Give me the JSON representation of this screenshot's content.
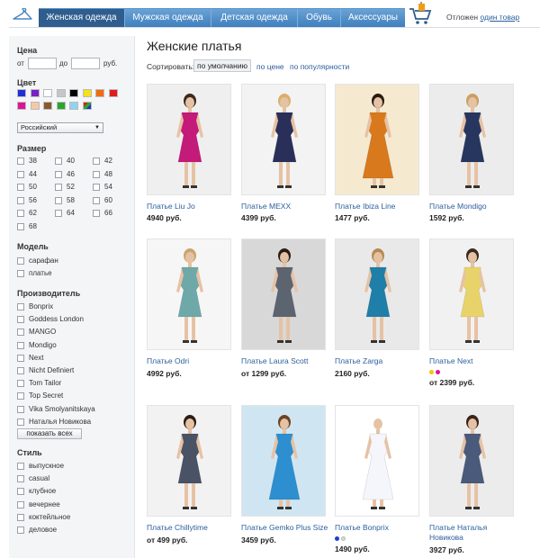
{
  "nav": {
    "tabs": [
      {
        "label": "Женская одежда",
        "active": true
      },
      {
        "label": "Мужская одежда",
        "active": false
      },
      {
        "label": "Детская одежда",
        "active": false
      },
      {
        "label": "Обувь",
        "active": false
      },
      {
        "label": "Аксессуары",
        "active": false
      }
    ],
    "deferred_text": "Отложен",
    "deferred_link": "один товар",
    "colors": {
      "bar": "#4a86c3",
      "active": "#2f5d8e"
    }
  },
  "sidebar": {
    "price": {
      "title": "Цена",
      "from": "от",
      "to": "до",
      "unit": "руб.",
      "from_value": "",
      "to_value": ""
    },
    "color": {
      "title": "Цвет",
      "swatches": [
        "#1f2fd4",
        "#7a1fc4",
        "#ffffff",
        "#c6c6c6",
        "#000000",
        "#f7e017",
        "#f26b0f",
        "#e11b1b",
        "#e0129a",
        "#f6c8a8",
        "#8a5a2b",
        "#28a52a",
        "#8fd3f0",
        "multicolor"
      ]
    },
    "country_select": "Российский",
    "size": {
      "title": "Размер",
      "values": [
        "38",
        "40",
        "42",
        "44",
        "46",
        "48",
        "50",
        "52",
        "54",
        "56",
        "58",
        "60",
        "62",
        "64",
        "66",
        "68"
      ]
    },
    "model": {
      "title": "Модель",
      "items": [
        "сарафан",
        "платье"
      ]
    },
    "brand": {
      "title": "Производитель",
      "items": [
        "Bonprix",
        "Goddess London",
        "MANGO",
        "Mondigo",
        "Next",
        "Nicht Definiert",
        "Tom Tailor",
        "Top Secret",
        "Vika Smolyanitskaya",
        "Наталья Новикова"
      ],
      "show_all": "показать всех"
    },
    "style": {
      "title": "Стиль",
      "items": [
        "выпускное",
        "casual",
        "клубное",
        "вечернее",
        "коктейльное",
        "деловое"
      ]
    }
  },
  "main": {
    "title": "Женские платья",
    "sort": {
      "label": "Сортировать:",
      "default": "по умолчанию",
      "by_price": "по цене",
      "by_popularity": "по популярности"
    },
    "products": [
      {
        "name": "Платье Liu Jo",
        "price": "4940 руб.",
        "dress": "#c41a7a",
        "bg": "#efefef",
        "hair": "#3a2a1e",
        "short": true,
        "dots": []
      },
      {
        "name": "Платье MEXX",
        "price": "4399 руб.",
        "dress": "#2a2f5a",
        "bg": "#f3f3f3",
        "hair": "#d8b06a",
        "short": true,
        "dots": []
      },
      {
        "name": "Платье Ibiza Line",
        "price": "1477 руб.",
        "dress": "#d9791e",
        "bg": "#f5ead0",
        "hair": "#2a1a12",
        "short": false,
        "dots": []
      },
      {
        "name": "Платье Mondigo",
        "price": "1592 руб.",
        "dress": "#27365e",
        "bg": "#ececec",
        "hair": "#c9a062",
        "short": true,
        "dots": []
      },
      {
        "name": "Платье Odri",
        "price": "4992 руб.",
        "dress": "#6fa8a8",
        "bg": "#f6f6f6",
        "hair": "#caa470",
        "short": true,
        "dots": []
      },
      {
        "name": "Платье Laura Scott",
        "price": "от 1299 руб.",
        "dress": "#5c6470",
        "bg": "#d8d8d8",
        "hair": "#2b1d16",
        "short": true,
        "dots": []
      },
      {
        "name": "Платье Zarga",
        "price": "2160 руб.",
        "dress": "#1f7fa8",
        "bg": "#e9e9e9",
        "hair": "#b88a52",
        "short": true,
        "dots": []
      },
      {
        "name": "Платье Next",
        "price": "от 2399 руб.",
        "dress": "#e8d36a",
        "bg": "#f1f1f1",
        "hair": "#3b2a1f",
        "short": true,
        "dots": [
          "#f1c40f",
          "#e0129a"
        ]
      },
      {
        "name": "Платье Chillytime",
        "price": "от 499 руб.",
        "dress": "#4a5266",
        "bg": "#f2f2f2",
        "hair": "#2a1e16",
        "short": true,
        "dots": []
      },
      {
        "name": "Платье Gemko Plus Size",
        "price": "3459 руб.",
        "dress": "#2d8fd0",
        "bg": "#cfe6f2",
        "hair": "#6b4426",
        "short": false,
        "dots": []
      },
      {
        "name": "Платье Bonprix",
        "price": "1490 руб.",
        "dress": "#f4f6fb",
        "bg": "#ffffff",
        "hair": "#ffffff",
        "short": false,
        "dots": [
          "#1f3fd4",
          "#d8d8d8"
        ]
      },
      {
        "name": "Платье Наталья Новикова",
        "price": "3927 руб.",
        "dress": "#4a5a7a",
        "bg": "#ececec",
        "hair": "#3a2418",
        "short": true,
        "dots": []
      }
    ]
  }
}
